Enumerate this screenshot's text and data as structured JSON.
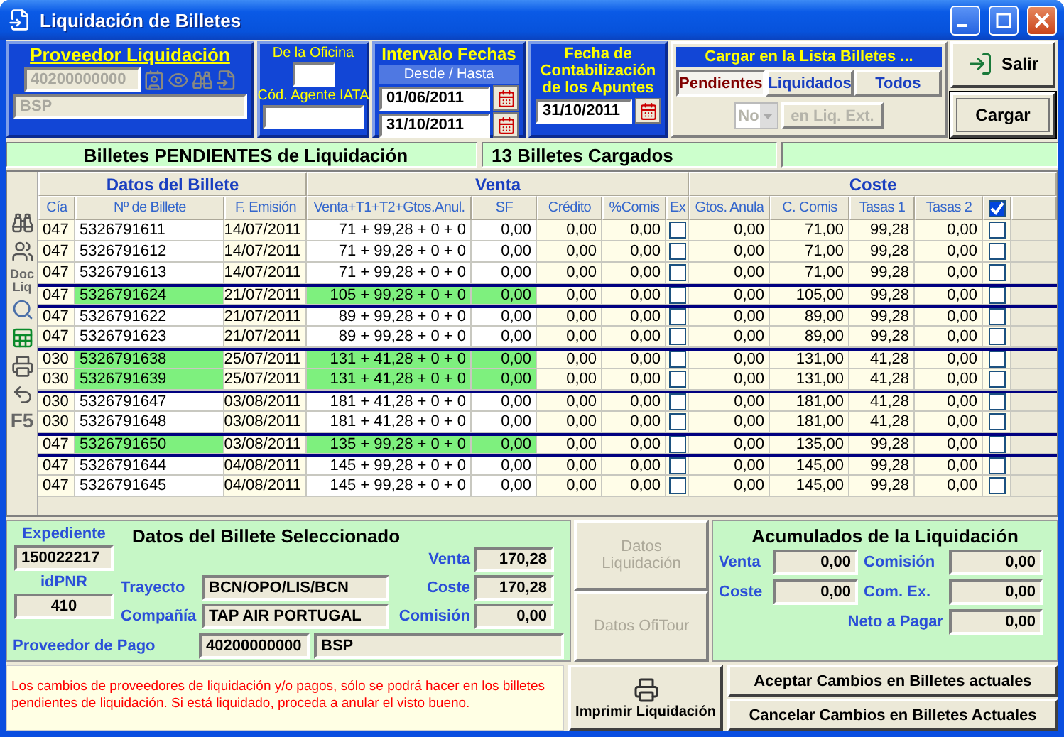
{
  "window": {
    "title": "Liquidación de Billetes"
  },
  "proveedor": {
    "title": "Proveedor Liquidación",
    "code": "40200000000",
    "name": "BSP",
    "disabled": true
  },
  "oficina": {
    "label": "De la Oficina",
    "iata_label": "Cód. Agente IATA"
  },
  "intervalo": {
    "title": "Intervalo Fechas",
    "subtitle": "Desde / Hasta",
    "from": "01/06/2011",
    "to": "31/10/2011"
  },
  "contabilizacion": {
    "title": "Fecha de Contabilización de los Apuntes",
    "date": "31/10/2011"
  },
  "cargar_lista": {
    "title": "Cargar en la Lista Billetes ...",
    "tabs": [
      {
        "label": "Pendientes",
        "selected": true
      },
      {
        "label": "Liquidados",
        "selected": false
      },
      {
        "label": "Todos",
        "selected": false
      }
    ],
    "liq_ext": {
      "value": "No",
      "button": "en Liq. Ext.",
      "disabled": true
    }
  },
  "buttons": [
    {
      "label": "Salir",
      "kind": "exit"
    },
    {
      "label": "Cargar",
      "kind": "default"
    }
  ],
  "status": [
    "Billetes PENDIENTES de Liquidación",
    "13 Billetes Cargados"
  ],
  "toolbar": [
    {
      "kind": "find"
    },
    {
      "kind": "people"
    },
    {
      "kind": "text",
      "label": "Doc Liq"
    },
    {
      "kind": "zoom"
    },
    {
      "kind": "sheet"
    },
    {
      "kind": "print"
    },
    {
      "kind": "undo"
    },
    {
      "kind": "text",
      "label": "F5"
    }
  ],
  "table": {
    "groups": [
      "Datos del Billete",
      "Venta",
      "Coste"
    ],
    "columns": [
      {
        "label": "Cía",
        "kind": "code"
      },
      {
        "label": "Nº de Billete",
        "kind": "text"
      },
      {
        "label": "F. Emisión",
        "kind": "date"
      },
      {
        "label": "Venta+T1+T2+Gtos.Anul.",
        "kind": "number"
      },
      {
        "label": "SF",
        "kind": "number"
      },
      {
        "label": "Crédito",
        "kind": "number"
      },
      {
        "label": "%Comis",
        "kind": "number"
      },
      {
        "label": "Ex",
        "kind": "check"
      },
      {
        "label": "Gtos. Anula",
        "kind": "number"
      },
      {
        "label": "C. Comis",
        "kind": "number"
      },
      {
        "label": "Tasas 1",
        "kind": "number"
      },
      {
        "label": "Tasas 2",
        "kind": "number"
      },
      {
        "kind": "check_all",
        "checked": true
      }
    ],
    "rows": [
      {
        "cia": "047",
        "numero": "5326791611",
        "emision": "14/07/2011",
        "venta": "71 + 99,28 + 0 + 0",
        "sf": "0,00",
        "credito": "0,00",
        "comis": "0,00",
        "ex": false,
        "gtos": "0,00",
        "ccomis": "71,00",
        "tasas1": "99,28",
        "tasas2": "0,00",
        "checked": false,
        "highlighted": false,
        "separator_above": false
      },
      {
        "cia": "047",
        "numero": "5326791612",
        "emision": "14/07/2011",
        "venta": "71 + 99,28 + 0 + 0",
        "sf": "0,00",
        "credito": "0,00",
        "comis": "0,00",
        "ex": false,
        "gtos": "0,00",
        "ccomis": "71,00",
        "tasas1": "99,28",
        "tasas2": "0,00",
        "checked": false,
        "highlighted": false,
        "separator_above": false
      },
      {
        "cia": "047",
        "numero": "5326791613",
        "emision": "14/07/2011",
        "venta": "71 + 99,28 + 0 + 0",
        "sf": "0,00",
        "credito": "0,00",
        "comis": "0,00",
        "ex": false,
        "gtos": "0,00",
        "ccomis": "71,00",
        "tasas1": "99,28",
        "tasas2": "0,00",
        "checked": false,
        "highlighted": false,
        "separator_above": false
      },
      {
        "cia": "047",
        "numero": "5326791624",
        "emision": "21/07/2011",
        "venta": "105 + 99,28 + 0 + 0",
        "sf": "0,00",
        "credito": "0,00",
        "comis": "0,00",
        "ex": false,
        "gtos": "0,00",
        "ccomis": "105,00",
        "tasas1": "99,28",
        "tasas2": "0,00",
        "checked": false,
        "highlighted": true,
        "separator_above": true
      },
      {
        "cia": "047",
        "numero": "5326791622",
        "emision": "21/07/2011",
        "venta": "89 + 99,28 + 0 + 0",
        "sf": "0,00",
        "credito": "0,00",
        "comis": "0,00",
        "ex": false,
        "gtos": "0,00",
        "ccomis": "89,00",
        "tasas1": "99,28",
        "tasas2": "0,00",
        "checked": false,
        "highlighted": false,
        "separator_above": true
      },
      {
        "cia": "047",
        "numero": "5326791623",
        "emision": "21/07/2011",
        "venta": "89 + 99,28 + 0 + 0",
        "sf": "0,00",
        "credito": "0,00",
        "comis": "0,00",
        "ex": false,
        "gtos": "0,00",
        "ccomis": "89,00",
        "tasas1": "99,28",
        "tasas2": "0,00",
        "checked": false,
        "highlighted": false,
        "separator_above": false
      },
      {
        "cia": "030",
        "numero": "5326791638",
        "emision": "25/07/2011",
        "venta": "131 + 41,28 + 0 + 0",
        "sf": "0,00",
        "credito": "0,00",
        "comis": "0,00",
        "ex": false,
        "gtos": "0,00",
        "ccomis": "131,00",
        "tasas1": "41,28",
        "tasas2": "0,00",
        "checked": false,
        "highlighted": true,
        "separator_above": true
      },
      {
        "cia": "030",
        "numero": "5326791639",
        "emision": "25/07/2011",
        "venta": "131 + 41,28 + 0 + 0",
        "sf": "0,00",
        "credito": "0,00",
        "comis": "0,00",
        "ex": false,
        "gtos": "0,00",
        "ccomis": "131,00",
        "tasas1": "41,28",
        "tasas2": "0,00",
        "checked": false,
        "highlighted": true,
        "separator_above": false
      },
      {
        "cia": "030",
        "numero": "5326791647",
        "emision": "03/08/2011",
        "venta": "181 + 41,28 + 0 + 0",
        "sf": "0,00",
        "credito": "0,00",
        "comis": "0,00",
        "ex": false,
        "gtos": "0,00",
        "ccomis": "181,00",
        "tasas1": "41,28",
        "tasas2": "0,00",
        "checked": false,
        "highlighted": false,
        "separator_above": true
      },
      {
        "cia": "030",
        "numero": "5326791648",
        "emision": "03/08/2011",
        "venta": "181 + 41,28 + 0 + 0",
        "sf": "0,00",
        "credito": "0,00",
        "comis": "0,00",
        "ex": false,
        "gtos": "0,00",
        "ccomis": "181,00",
        "tasas1": "41,28",
        "tasas2": "0,00",
        "checked": false,
        "highlighted": false,
        "separator_above": false
      },
      {
        "cia": "047",
        "numero": "5326791650",
        "emision": "03/08/2011",
        "venta": "135 + 99,28 + 0 + 0",
        "sf": "0,00",
        "credito": "0,00",
        "comis": "0,00",
        "ex": false,
        "gtos": "0,00",
        "ccomis": "135,00",
        "tasas1": "99,28",
        "tasas2": "0,00",
        "checked": false,
        "highlighted": true,
        "separator_above": true
      },
      {
        "cia": "047",
        "numero": "5326791644",
        "emision": "04/08/2011",
        "venta": "145 + 99,28 + 0 + 0",
        "sf": "0,00",
        "credito": "0,00",
        "comis": "0,00",
        "ex": false,
        "gtos": "0,00",
        "ccomis": "145,00",
        "tasas1": "99,28",
        "tasas2": "0,00",
        "checked": false,
        "highlighted": false,
        "separator_above": true
      },
      {
        "cia": "047",
        "numero": "5326791645",
        "emision": "04/08/2011",
        "venta": "145 + 99,28 + 0 + 0",
        "sf": "0,00",
        "credito": "0,00",
        "comis": "0,00",
        "ex": false,
        "gtos": "0,00",
        "ccomis": "145,00",
        "tasas1": "99,28",
        "tasas2": "0,00",
        "checked": false,
        "highlighted": false,
        "separator_above": false
      }
    ]
  },
  "seleccionado": {
    "title": "Datos del Billete Seleccionado",
    "expediente": {
      "label": "Expediente",
      "value": "150022217"
    },
    "idpnr": {
      "label": "idPNR",
      "value": "410"
    },
    "venta": {
      "label": "Venta",
      "value": "170,28"
    },
    "trayecto": {
      "label": "Trayecto",
      "value": "BCN/OPO/LIS/BCN"
    },
    "coste": {
      "label": "Coste",
      "value": "170,28"
    },
    "compania": {
      "label": "Compañía",
      "value": "TAP AIR PORTUGAL"
    },
    "comision": {
      "label": "Comisión",
      "value": "0,00"
    },
    "proveedor_pago": {
      "label": "Proveedor de Pago",
      "code": "40200000000",
      "name": "BSP"
    }
  },
  "side_buttons": [
    {
      "label": "Datos Liquidación",
      "disabled": true
    },
    {
      "label": "Datos OfiTour",
      "disabled": true
    }
  ],
  "acumulados": {
    "title": "Acumulados de la Liquidación",
    "venta": {
      "label": "Venta",
      "value": "0,00"
    },
    "comision": {
      "label": "Comisión",
      "value": "0,00"
    },
    "coste": {
      "label": "Coste",
      "value": "0,00"
    },
    "com_ex": {
      "label": "Com. Ex.",
      "value": "0,00"
    },
    "neto": {
      "label": "Neto a Pagar",
      "value": "0,00"
    }
  },
  "message": "Los cambios de proveedores de liquidación y/o pagos, sólo se podrá hacer en los billetes pendientes de liquidación. Si está liquidado, proceda a anular el visto bueno.",
  "print_button": "Imprimir Liquidación",
  "actions": [
    "Aceptar Cambios en Billetes actuales",
    "Cancelar Cambios en Billetes Actuales"
  ]
}
